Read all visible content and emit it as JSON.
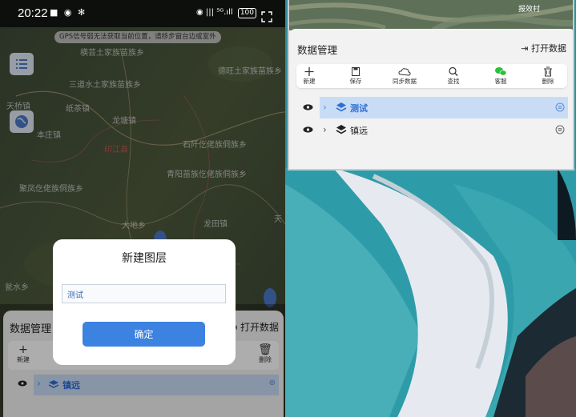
{
  "left_screen": {
    "status": {
      "time": "20:22",
      "left_icons": "■ ◉ ✻",
      "right_icons": "◉ ||| ⁵ᴳ.ıll",
      "battery": "100"
    },
    "gps_banner": "GPS信号弱无法获取当前位置，请移步窗台边或室外",
    "map_labels": [
      "横芸土家族苗族乡",
      "三道水土家族苗族乡",
      "德旺土家族苗族乡",
      "天桥镇",
      "纸茶镇",
      "龙塘镇",
      "本庄镇",
      "印江县",
      "石阡仡佬族侗族乡",
      "青阳苗族仡佬族侗族乡",
      "聚凤仡佬族侗族乡",
      "大地乡",
      "龙田镇",
      "天",
      "瓮水乡"
    ],
    "panel": {
      "title": "数据管理",
      "open_label": "打开数据",
      "new_label": "新建",
      "delete_label": "删除",
      "row_name": "镇远"
    },
    "dialog": {
      "title": "新建图层",
      "input_value": "测试",
      "confirm_label": "确定"
    }
  },
  "right_screen": {
    "map_label": "报效村",
    "title": "数据管理",
    "open_label": "打开数据",
    "toolbar": [
      "新建",
      "保存",
      "同步数据",
      "查找",
      "客服",
      "删除"
    ],
    "layers": [
      {
        "name": "测试",
        "selected": true
      },
      {
        "name": "镇远",
        "selected": false
      }
    ]
  },
  "colors": {
    "accent": "#3c82e0",
    "selected_row": "#c9dcf5",
    "wechat_green": "#2dbf3a"
  }
}
